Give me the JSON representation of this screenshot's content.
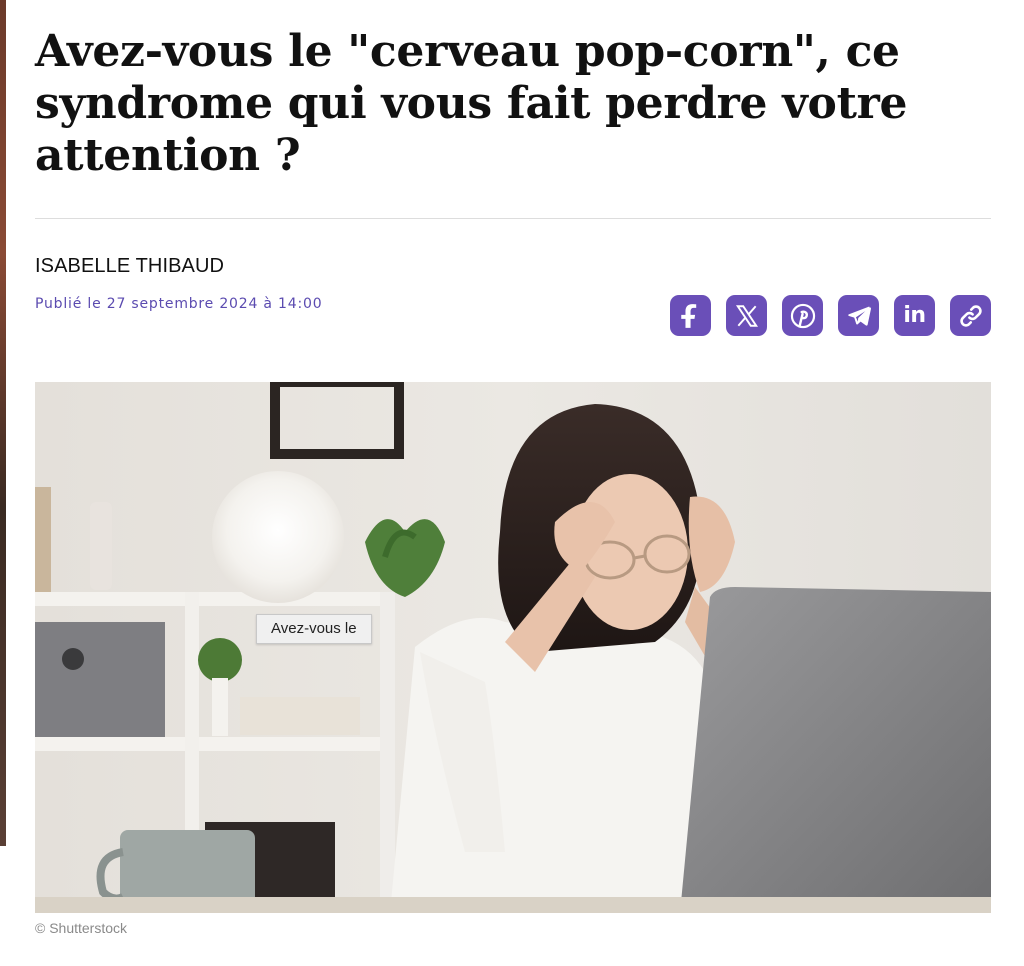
{
  "article": {
    "headline": "Avez-vous le \"cerveau pop-corn\", ce syndrome qui vous fait perdre votre attention ?",
    "author": "ISABELLE THIBAUD",
    "published": "Publié le 27 septembre 2024 à 14:00"
  },
  "share": {
    "buttons": [
      {
        "label": "f",
        "icon": "facebook-icon"
      },
      {
        "label": "X",
        "icon": "x-icon"
      },
      {
        "label": "P",
        "icon": "pinterest-icon"
      },
      {
        "label": "",
        "icon": "telegram-icon"
      },
      {
        "label": "in",
        "icon": "linkedin-icon"
      },
      {
        "label": "",
        "icon": "link-icon"
      }
    ],
    "color": "#6a4fb8"
  },
  "image": {
    "tooltip": "Avez-vous le",
    "credit": "© Shutterstock"
  },
  "colors": {
    "accent": "#6a4fb8",
    "date_text": "#5b4bb0",
    "headline_text": "#111111"
  }
}
